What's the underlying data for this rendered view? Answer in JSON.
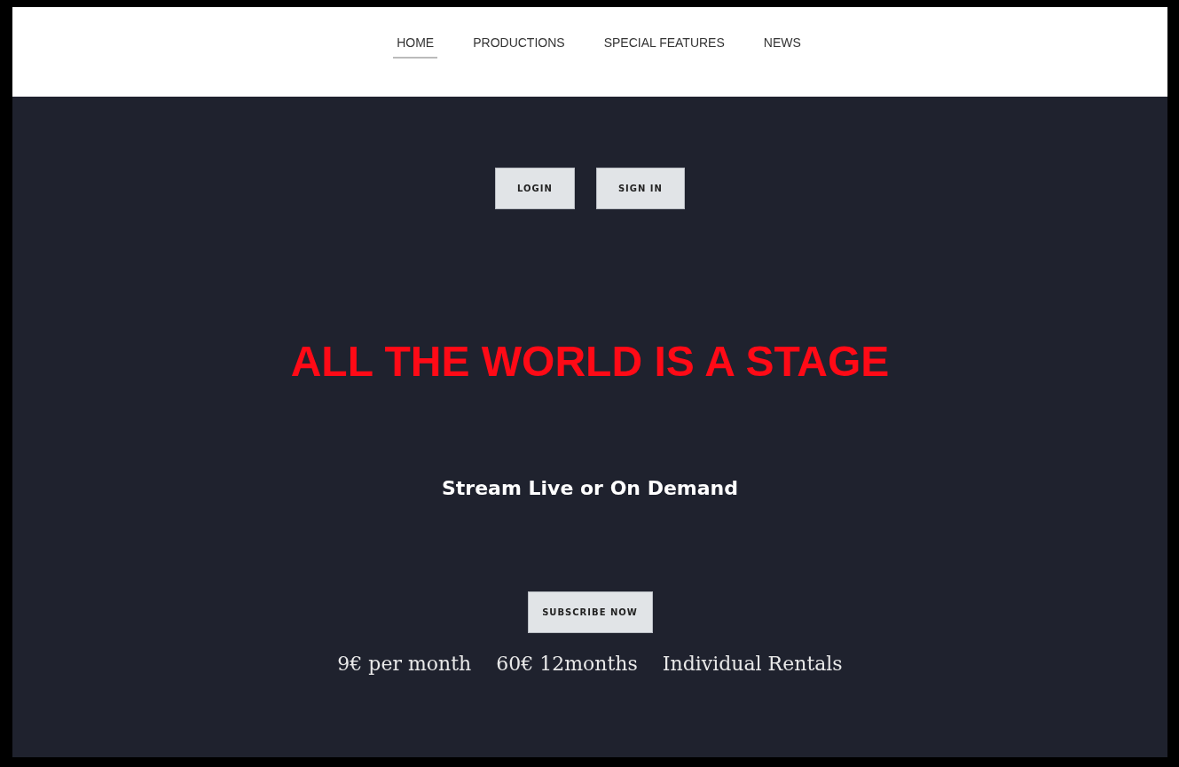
{
  "nav": [
    {
      "label": "HOME",
      "selected": true
    },
    {
      "label": "PRODUCTIONS",
      "selected": false
    },
    {
      "label": "SPECIAL FEATURES",
      "selected": false
    },
    {
      "label": "NEWS",
      "selected": false
    }
  ],
  "auth_buttons": [
    "LOGIN",
    "SIGN IN"
  ],
  "headline": "ALL THE WORLD IS A STAGE",
  "tagline": "Stream Live or On Demand",
  "cta": "SUBSCRIBE NOW",
  "pricing": [
    "9€ per month",
    "60€ 12months",
    "Individual Rentals"
  ]
}
